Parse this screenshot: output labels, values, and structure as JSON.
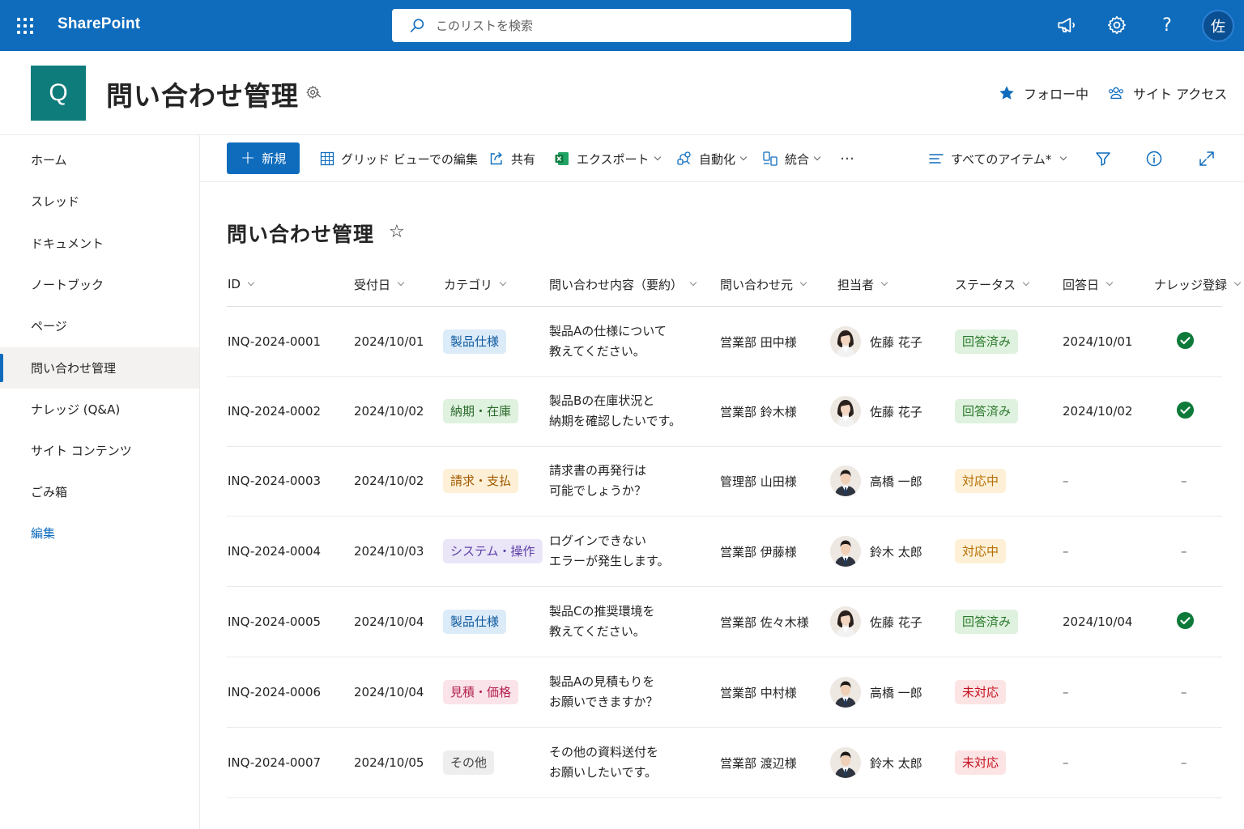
{
  "suite": {
    "brand": "SharePoint",
    "search_placeholder": "このリストを検索",
    "user_initial": "佐"
  },
  "site": {
    "logo_letter": "Q",
    "title": "問い合わせ管理",
    "follow_label": "フォロー中",
    "access_label": "サイト アクセス"
  },
  "nav": {
    "items": [
      {
        "label": "ホーム"
      },
      {
        "label": "スレッド"
      },
      {
        "label": "ドキュメント"
      },
      {
        "label": "ノートブック"
      },
      {
        "label": "ページ"
      },
      {
        "label": "問い合わせ管理",
        "active": true
      },
      {
        "label": "ナレッジ (Q&A)"
      },
      {
        "label": "サイト コンテンツ"
      },
      {
        "label": "ごみ箱"
      }
    ],
    "edit_label": "編集"
  },
  "commands": {
    "new_label": "新規",
    "grid_edit_label": "グリッド ビューでの編集",
    "share_label": "共有",
    "export_label": "エクスポート",
    "automate_label": "自動化",
    "integrate_label": "統合",
    "more_label": "…",
    "view_label": "すべてのアイテム*"
  },
  "list": {
    "title": "問い合わせ管理",
    "columns": {
      "id": "ID",
      "received": "受付日",
      "category": "カテゴリ",
      "summary": "問い合わせ内容（要約）",
      "from": "問い合わせ元",
      "assignee": "担当者",
      "status": "ステータス",
      "answered": "回答日",
      "knowledge": "ナレッジ登録"
    },
    "rows": [
      {
        "id": "INQ-2024-0001",
        "received": "2024/10/01",
        "category": "製品仕様",
        "summary1": "製品Aの仕様について",
        "summary2": "教えてください。",
        "from": "営業部 田中様",
        "assignee": "佐藤 花子",
        "status": "回答済み",
        "answered": "2024/10/01",
        "knowledge": "check"
      },
      {
        "id": "INQ-2024-0002",
        "received": "2024/10/02",
        "category": "納期・在庫",
        "summary1": "製品Bの在庫状況と",
        "summary2": "納期を確認したいです。",
        "from": "営業部 鈴木様",
        "assignee": "佐藤 花子",
        "status": "回答済み",
        "answered": "2024/10/02",
        "knowledge": "check"
      },
      {
        "id": "INQ-2024-0003",
        "received": "2024/10/02",
        "category": "請求・支払",
        "summary1": "請求書の再発行は",
        "summary2": "可能でしょうか？",
        "from": "管理部 山田様",
        "assignee": "高橋 一郎",
        "status": "対応中",
        "answered": "–",
        "knowledge": "–"
      },
      {
        "id": "INQ-2024-0004",
        "received": "2024/10/03",
        "category": "システム・操作",
        "summary1": "ログインできない",
        "summary2": "エラーが発生します。",
        "from": "営業部 伊藤様",
        "assignee": "鈴木 太郎",
        "status": "対応中",
        "answered": "–",
        "knowledge": "–"
      },
      {
        "id": "INQ-2024-0005",
        "received": "2024/10/04",
        "category": "製品仕様",
        "summary1": "製品Cの推奨環境を",
        "summary2": "教えてください。",
        "from": "営業部 佐々木様",
        "assignee": "佐藤 花子",
        "status": "回答済み",
        "answered": "2024/10/04",
        "knowledge": "check"
      },
      {
        "id": "INQ-2024-0006",
        "received": "2024/10/04",
        "category": "見積・価格",
        "summary1": "製品Aの見積もりを",
        "summary2": "お願いできますか？",
        "from": "営業部 中村様",
        "assignee": "高橋 一郎",
        "status": "未対応",
        "answered": "–",
        "knowledge": "–"
      },
      {
        "id": "INQ-2024-0007",
        "received": "2024/10/05",
        "category": "その他",
        "summary1": "その他の資料送付を",
        "summary2": "お願いしたいです。",
        "from": "営業部 渡辺様",
        "assignee": "鈴木 太郎",
        "status": "未対応",
        "answered": "–",
        "knowledge": "–"
      }
    ]
  },
  "colors": {
    "brand_blue": "#0f6cbd",
    "site_logo": "#0e7c7b",
    "cat_product": {
      "bg": "#dcebf8",
      "fg": "#0f5a9e"
    },
    "cat_delivery": {
      "bg": "#dff1df",
      "fg": "#2b6a2b"
    },
    "cat_billing": {
      "bg": "#fdf0d7",
      "fg": "#a35a00"
    },
    "cat_system": {
      "bg": "#ebe5f8",
      "fg": "#5b3ea6"
    },
    "cat_quote": {
      "bg": "#fbe3ea",
      "fg": "#b4234f"
    },
    "cat_other": {
      "bg": "#eeeeee",
      "fg": "#424242"
    },
    "status_done": {
      "bg": "#dff1df",
      "fg": "#2b7a2b"
    },
    "status_progress": {
      "bg": "#fdf0d7",
      "fg": "#b86e00"
    },
    "status_open": {
      "bg": "#fde4e4",
      "fg": "#c50f1f"
    },
    "check_green": "#0e7a3a"
  }
}
